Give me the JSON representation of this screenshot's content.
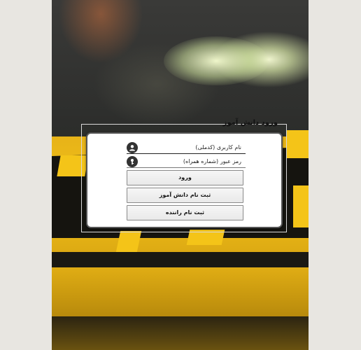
{
  "login_form": {
    "legend": "ورود دانش آموز",
    "username": {
      "placeholder": "نام کاربری (کدملی)",
      "value": "",
      "icon": "user-icon"
    },
    "password": {
      "placeholder": "رمز عبور (شماره همراه)",
      "value": "",
      "icon": "key-icon"
    },
    "buttons": {
      "login": "ورود",
      "register_student": "ثبت نام دانش آموز",
      "register_driver": "ثبت نام راننده"
    }
  },
  "colors": {
    "page_background": "#e8e6e1",
    "card_background": "#ffffff",
    "taxi_yellow": "#f2c21a",
    "icon_dark": "#333333"
  }
}
